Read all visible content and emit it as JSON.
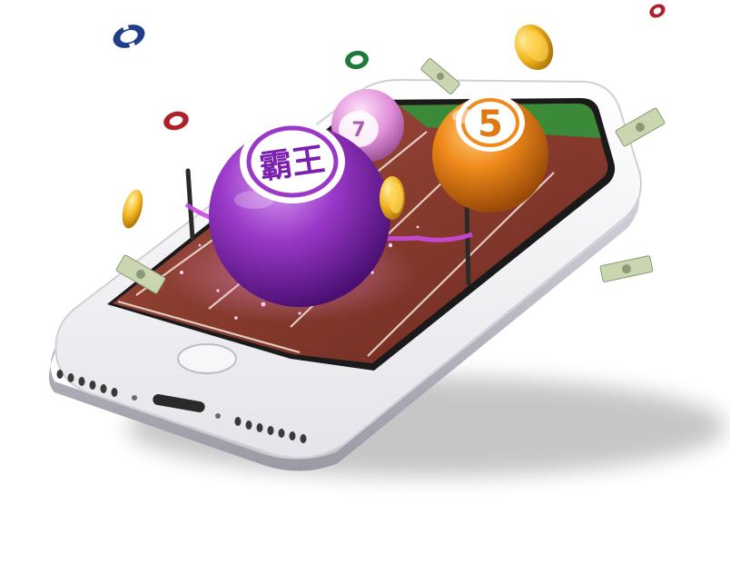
{
  "scene": {
    "subject": "smartphone-lottery-illustration"
  },
  "balls": {
    "purple": {
      "label": "霸王",
      "color": "#8d2fc0"
    },
    "orange": {
      "label": "5",
      "color": "#f08a1a"
    },
    "pink": {
      "label": "7",
      "color": "#e08fd8"
    }
  },
  "colors": {
    "phone_body": "#f2f2f5",
    "phone_edge": "#c9c9d2",
    "track": "#8a3a2e",
    "grass": "#3a8a3a",
    "gold": "#f2b51e",
    "cash": "#c9d6b0"
  },
  "icons": [
    "poker-chip-icon",
    "gold-coin-icon",
    "dollar-bill-icon",
    "home-button-icon",
    "lightning-port-icon"
  ]
}
